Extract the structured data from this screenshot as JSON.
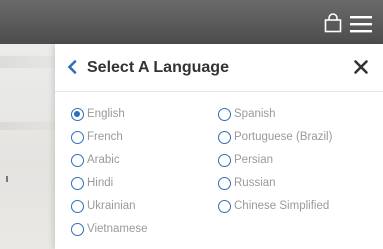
{
  "modal": {
    "title": "Select A Language"
  },
  "languages": [
    {
      "label": "English",
      "checked": true
    },
    {
      "label": "French",
      "checked": false
    },
    {
      "label": "Arabic",
      "checked": false
    },
    {
      "label": "Hindi",
      "checked": false
    },
    {
      "label": "Ukrainian",
      "checked": false
    },
    {
      "label": "Vietnamese",
      "checked": false
    },
    {
      "label": "Spanish",
      "checked": false
    },
    {
      "label": "Portuguese (Brazil)",
      "checked": false
    },
    {
      "label": "Persian",
      "checked": false
    },
    {
      "label": "Russian",
      "checked": false
    },
    {
      "label": "Chinese Simplified",
      "checked": false
    }
  ],
  "icons": {
    "header_bag": "shopping-bag-icon",
    "header_menu": "hamburger-menu-icon",
    "back": "chevron-left-icon",
    "close": "close-icon"
  },
  "colors": {
    "accent": "#2f6fb6",
    "topbar": "#555555",
    "label_text": "#9a9a9a"
  }
}
